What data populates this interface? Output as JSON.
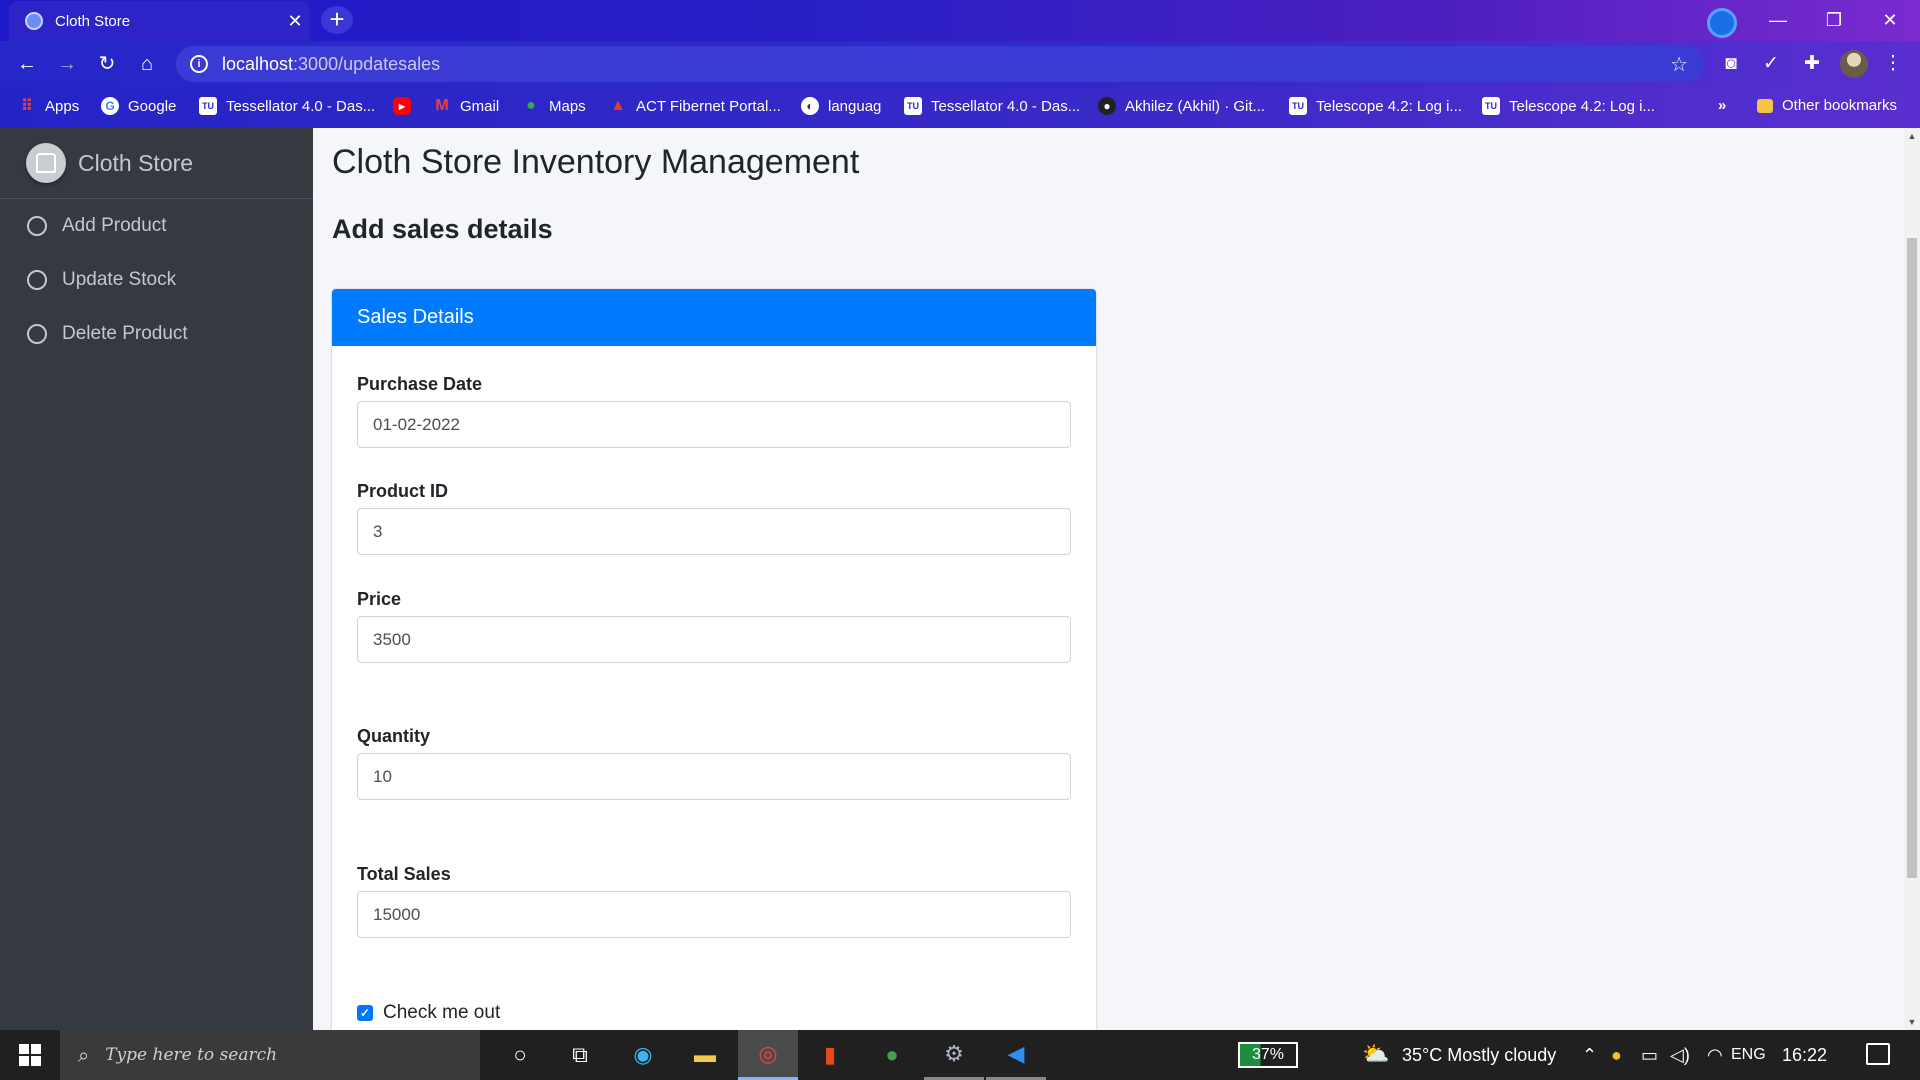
{
  "browser": {
    "tab_title": "Cloth Store",
    "tab_close": "✕",
    "new_tab": "+",
    "url_host": "localhost",
    "url_path": ":3000/updatesales",
    "bookmarks": [
      {
        "label": "Apps",
        "icon": "apps-icon",
        "glyph": "⠿"
      },
      {
        "label": "Google",
        "icon": "google-icon",
        "glyph": "G"
      },
      {
        "label": "Tessellator 4.0 - Das...",
        "icon": "tessellator-icon",
        "glyph": "TU"
      },
      {
        "label": "",
        "icon": "youtube-icon",
        "glyph": "▶"
      },
      {
        "label": "Gmail",
        "icon": "gmail-icon",
        "glyph": "M"
      },
      {
        "label": "Maps",
        "icon": "maps-icon",
        "glyph": "📍"
      },
      {
        "label": "ACT Fibernet Portal...",
        "icon": "act-icon",
        "glyph": "▲"
      },
      {
        "label": "languag",
        "icon": "language-icon",
        "glyph": "◐"
      },
      {
        "label": "Tessellator 4.0 - Das...",
        "icon": "tessellator-icon",
        "glyph": "TU"
      },
      {
        "label": "Akhilez (Akhil) · Git...",
        "icon": "github-icon",
        "glyph": "●"
      },
      {
        "label": "Telescope 4.2: Log i...",
        "icon": "telescope-icon",
        "glyph": "TU"
      },
      {
        "label": "Telescope 4.2: Log i...",
        "icon": "telescope-icon",
        "glyph": "TU"
      }
    ],
    "more_bookmarks": "»",
    "other_bookmarks": "Other bookmarks"
  },
  "sidebar": {
    "brand": "Cloth Store",
    "items": [
      {
        "label": "Add Product"
      },
      {
        "label": "Update Stock"
      },
      {
        "label": "Delete Product"
      }
    ]
  },
  "main": {
    "page_title": "Cloth Store Inventory Management",
    "section_title": "Add sales details",
    "card_title": "Sales Details",
    "fields": [
      {
        "label": "Purchase Date",
        "value": "01-02-2022"
      },
      {
        "label": "Product ID",
        "value": "3"
      },
      {
        "label": "Price",
        "value": "3500"
      },
      {
        "label": "Quantity",
        "value": "10"
      },
      {
        "label": "Total Sales",
        "value": "15000"
      }
    ],
    "checkbox_label": "Check me out",
    "checkbox_checked": true
  },
  "taskbar": {
    "search_placeholder": "Type here to search",
    "battery": "37%",
    "weather": "35°C  Mostly cloudy",
    "language": "ENG",
    "time": "16:22"
  },
  "colors": {
    "accent": "#007bff",
    "sidebar_bg": "#343a40",
    "content_bg": "#f4f6f9"
  }
}
